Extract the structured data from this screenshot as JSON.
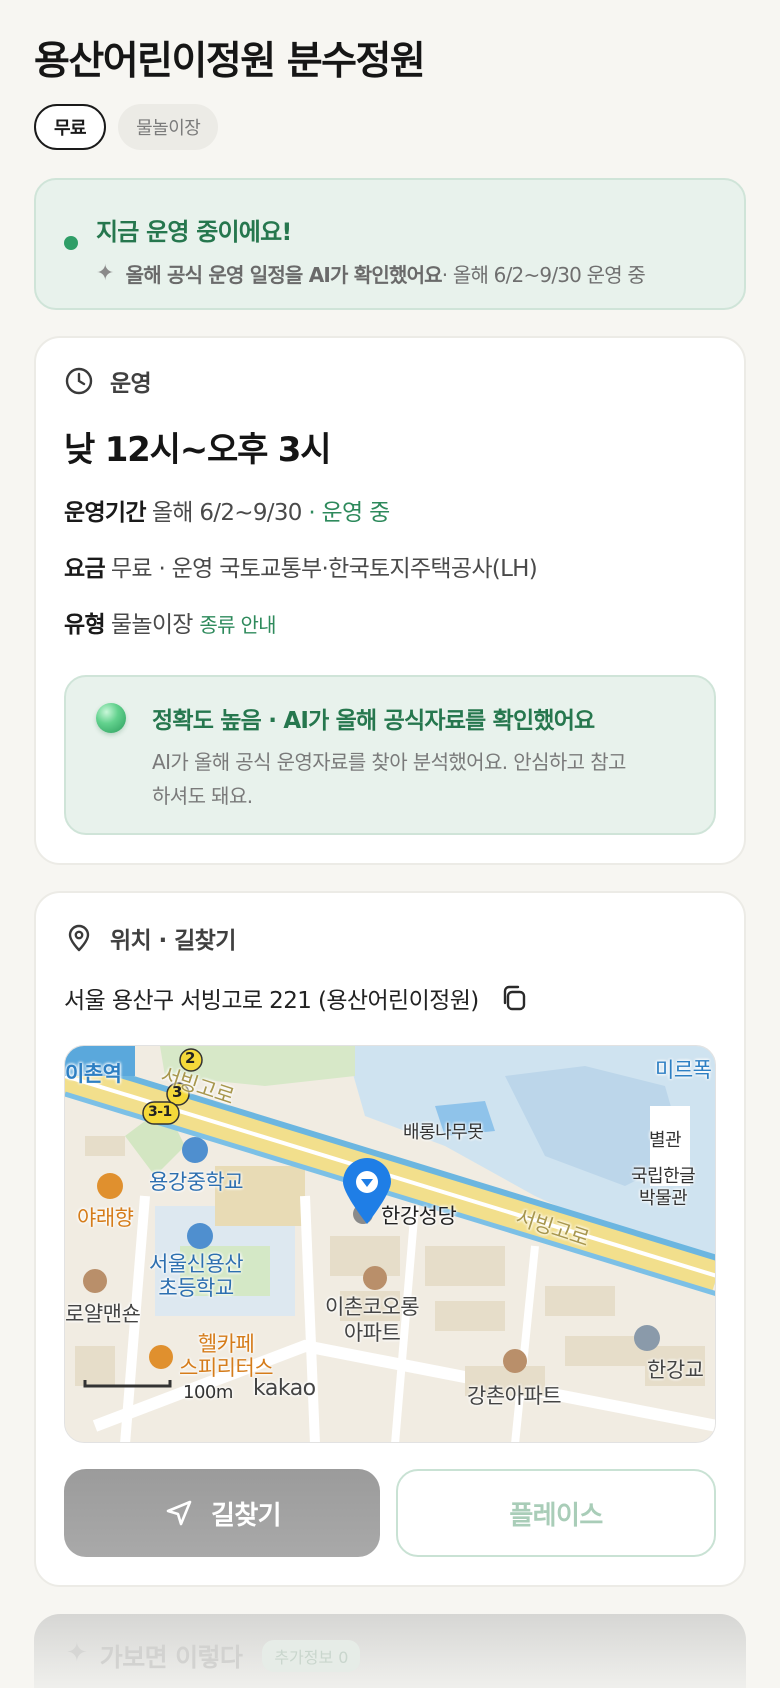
{
  "title": "용산어린이정원 분수정원",
  "chips": [
    {
      "label": "무료",
      "active": true
    },
    {
      "label": "물놀이장",
      "active": false
    }
  ],
  "status": {
    "title": "지금 운영 중이에요!",
    "sub_strong": "올해 공식 운영 일정을 AI가 확인했어요",
    "sub_rest": " · 올해 6/2~9/30 운영 중"
  },
  "operation": {
    "section_label": "운영",
    "hours": "낮 12시~오후 3시",
    "period_label": "운영기간",
    "period_value": "올해 6/2~9/30",
    "period_status": " · 운영 중",
    "fee_label": "요금",
    "fee_value": "무료 · 운영 국토교통부·한국토지주택공사(LH)",
    "type_label": "유형",
    "type_value": "물놀이장",
    "type_link": "종류 안내",
    "accuracy_title": "정확도 높음 · AI가 올해 공식자료를 확인했어요",
    "accuracy_body": "AI가 올해 공식 운영자료를 찾아 분석했어요. 안심하고 참고하셔도 돼요."
  },
  "location": {
    "section_label": "위치 · 길찾기",
    "address": "서울 용산구 서빙고로 221 (용산어린이정원)",
    "map_labels": {
      "ichon_station": "이촌역",
      "seobinggo_1": "서빙고로",
      "seobinggo_2": "서빙고로",
      "mireu": "미르폭",
      "baerong": "배롱나무못",
      "byeolgwan": "별관",
      "museum": "국립한글\n박물관",
      "yonggang_middle": "용강중학교",
      "yaraehyang": "야래향",
      "hangang_church": "한강성당",
      "shinyongsan_elem": "서울신용산\n초등학교",
      "mansion": "로얄맨숀",
      "ichon_kolon": "이촌코오롱\n아파트",
      "cafe": "헬카페\n스피리터스",
      "hangang_bridge": "한강교",
      "gangchon": "강촌아파트",
      "scale": "100m",
      "brand": "kakao",
      "badge_2": "2",
      "badge_3": "3",
      "badge_3_1": "3-1"
    },
    "btn_directions": "길찾기",
    "btn_place": "플레이스"
  },
  "next_section": {
    "title": "가보면 이렇다",
    "badge": "추가정보 0"
  },
  "colors": {
    "accent_green": "#2e8a5c",
    "banner_bg": "#e8f2ec",
    "map_pin": "#1f7ee6"
  }
}
